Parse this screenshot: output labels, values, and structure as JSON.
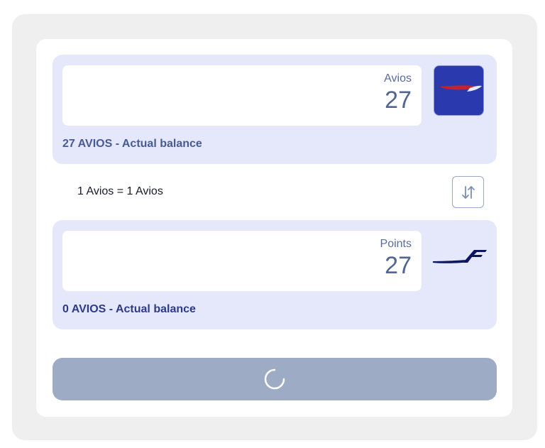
{
  "from": {
    "currency_label": "Avios",
    "amount": "27",
    "balance_text": "27 AVIOS - Actual balance",
    "logo": "british-airways-logo"
  },
  "rate": {
    "text": "1 Avios = 1 Avios"
  },
  "swap": {
    "icon": "swap-vertical-arrows-icon"
  },
  "to": {
    "currency_label": "Points",
    "amount": "27",
    "balance_text": "0 AVIOS - Actual balance",
    "logo": "finnair-logo"
  },
  "submit": {
    "state": "loading",
    "icon": "spinner-icon"
  },
  "colors": {
    "panel_bg": "#e5e8fb",
    "button_bg": "#9dabc5",
    "ba_logo_bg": "#2a3aae",
    "finnair_navy": "#0b1560"
  }
}
